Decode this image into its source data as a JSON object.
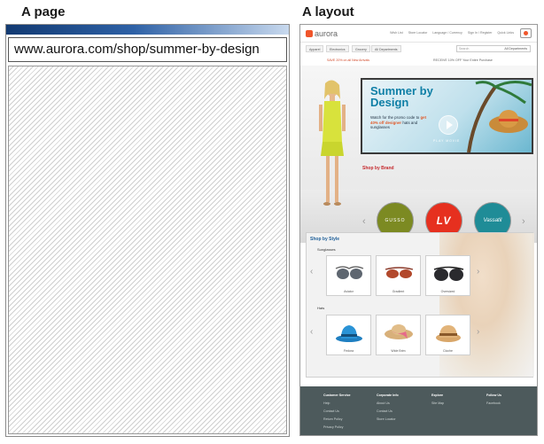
{
  "headings": {
    "page": "A page",
    "layout": "A layout"
  },
  "page_mock": {
    "url": "www.aurora.com/shop/summer-by-design"
  },
  "site": {
    "logo": "aurora",
    "top_links": [
      "Wish List",
      "Store Locator",
      "Language / Currency",
      "Sign In / Register",
      "Quick Links"
    ],
    "nav_tabs": [
      "Apparel",
      "Electronics",
      "Grocery",
      "All Departments"
    ],
    "search_placeholder": "Search",
    "search_scope": "All Departments",
    "promo_left": "SAVE 20% on all New Arrivals",
    "promo_right": "RECEIVE 10% OFF Your Entire Purchase",
    "hero": {
      "title": "Summer by Design",
      "text_before": "Watch for the promo code to",
      "text_highlight": "get 40% off designer",
      "text_after": "hats and sunglasses",
      "play_label": "PLAY MOVIE"
    },
    "brands_title": "Shop by Brand",
    "brands": [
      "GUSSO",
      "LV",
      "Vassatil"
    ],
    "style_title": "Shop by Style",
    "sunglasses_title": "Sunglasses",
    "sunglasses": [
      "Aviator",
      "Gradient",
      "Oversized"
    ],
    "hats_title": "Hats",
    "hats": [
      "Fedora",
      "Wide Brim",
      "Cloche"
    ],
    "footer": [
      {
        "heading": "Customer Service",
        "links": [
          "Help",
          "Contact Us",
          "Return Policy",
          "Privacy Policy"
        ]
      },
      {
        "heading": "Corporate Info",
        "links": [
          "About Us",
          "Contact Us",
          "Store Locator"
        ]
      },
      {
        "heading": "Explore",
        "links": [
          "Site Map"
        ]
      },
      {
        "heading": "Follow Us",
        "links": [
          "Facebook"
        ]
      }
    ]
  },
  "colors": {
    "accent_orange": "#f0552a",
    "hero_title_blue": "#0f7fa6",
    "brand_red": "#c5282c",
    "style_blue": "#1e5f99",
    "footer_bg": "#4d5a5c"
  }
}
